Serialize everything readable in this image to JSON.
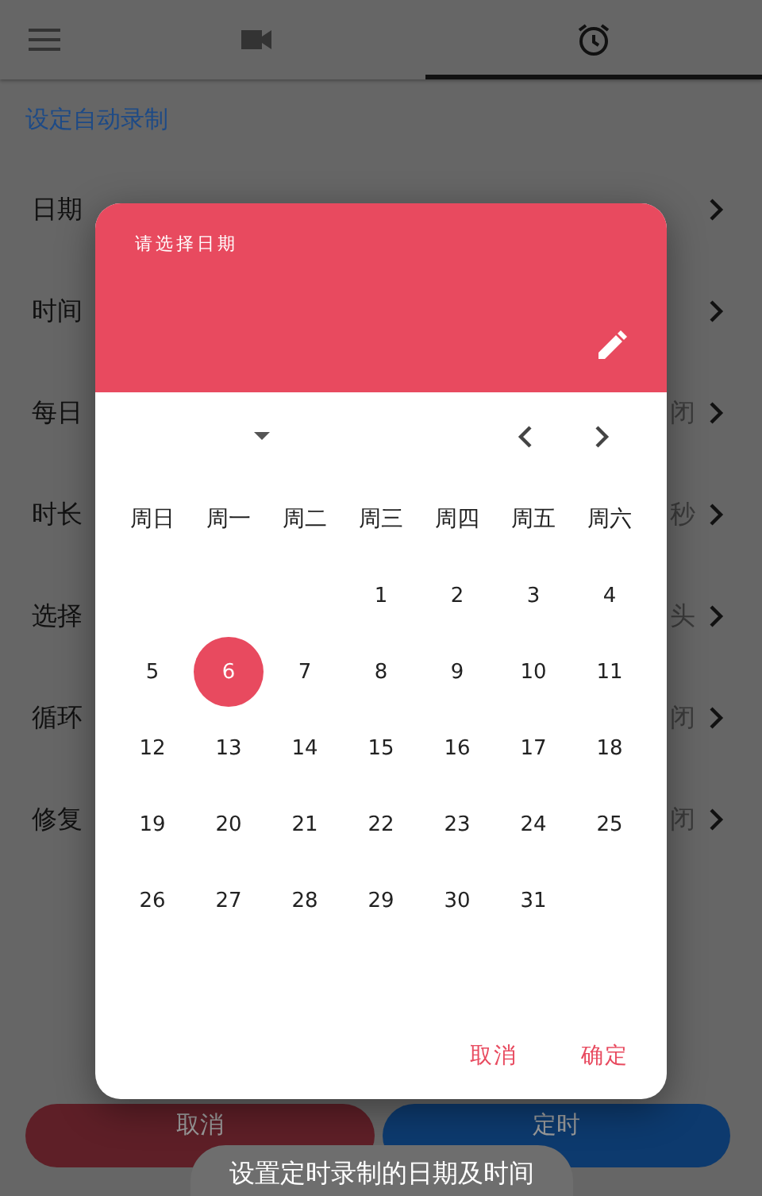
{
  "app_bar": {
    "tabs": [
      {
        "kind": "video",
        "selected": false
      },
      {
        "kind": "alarm",
        "selected": true
      }
    ]
  },
  "page": {
    "title": "设定自动录制",
    "rows": [
      {
        "label": "日期"
      },
      {
        "label": "时间"
      },
      {
        "label": "每日",
        "value": "闭"
      },
      {
        "label": "时长",
        "value": "秒"
      },
      {
        "label": "选择",
        "value": "头"
      },
      {
        "label": "循环",
        "value": "闭"
      },
      {
        "label": "修复",
        "value": "闭"
      }
    ],
    "buttons": [
      {
        "label": "取消",
        "kind": "cancel"
      },
      {
        "label": "定时",
        "kind": "confirm"
      }
    ]
  },
  "dialog": {
    "title": "请选择日期",
    "weekdays": [
      "周日",
      "周一",
      "周二",
      "周三",
      "周四",
      "周五",
      "周六"
    ],
    "weeks": [
      [
        {
          "label": "1",
          "selected": false
        },
        {
          "label": "2",
          "selected": false
        },
        {
          "label": "3",
          "selected": false
        },
        {
          "label": "4",
          "selected": false
        }
      ],
      [
        {
          "label": "5",
          "selected": false
        },
        {
          "label": "6",
          "selected": true
        },
        {
          "label": "7",
          "selected": false
        },
        {
          "label": "8",
          "selected": false
        },
        {
          "label": "9",
          "selected": false
        },
        {
          "label": "10",
          "selected": false
        },
        {
          "label": "11",
          "selected": false
        }
      ],
      [
        {
          "label": "12",
          "selected": false
        },
        {
          "label": "13",
          "selected": false
        },
        {
          "label": "14",
          "selected": false
        },
        {
          "label": "15",
          "selected": false
        },
        {
          "label": "16",
          "selected": false
        },
        {
          "label": "17",
          "selected": false
        },
        {
          "label": "18",
          "selected": false
        }
      ],
      [
        {
          "label": "19",
          "selected": false
        },
        {
          "label": "20",
          "selected": false
        },
        {
          "label": "21",
          "selected": false
        },
        {
          "label": "22",
          "selected": false
        },
        {
          "label": "23",
          "selected": false
        },
        {
          "label": "24",
          "selected": false
        },
        {
          "label": "25",
          "selected": false
        }
      ],
      [
        {
          "label": "26",
          "selected": false
        },
        {
          "label": "27",
          "selected": false
        },
        {
          "label": "28",
          "selected": false
        },
        {
          "label": "29",
          "selected": false
        },
        {
          "label": "30",
          "selected": false
        },
        {
          "label": "31",
          "selected": false
        }
      ]
    ],
    "actions": [
      "取消",
      "确定"
    ]
  },
  "toast": "设置定时录制的日期及时间"
}
